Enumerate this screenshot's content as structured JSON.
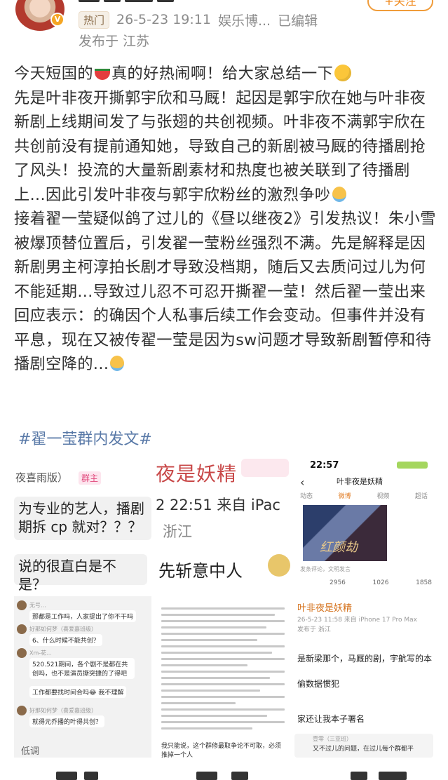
{
  "header": {
    "verified_mark": "V",
    "hot_tag": "热门",
    "timestamp": "26-5-23 19:11",
    "source": "娱乐博...",
    "edited": "已编辑",
    "location": "发布于 江苏",
    "follow_label": "+关注"
  },
  "post": {
    "paragraphs": [
      "今天短国的",
      "真的好热闹啊！给大家总结一下",
      "先是叶非夜开撕郭宇欣和马厩！起因是郭宇欣在她与叶非夜新剧上线期间发了与张翅的共创视频。叶非夜不满郭宇欣在共创前没有提前通知她，导致自己的新剧被马厩的待播剧抢了风头！投流的大量新剧素材和热度也被关联到了待播剧上...因此引发叶非夜与郭宇欣粉丝的激烈争吵",
      "接着翟一莹疑似鸽了过儿的《昼以继夜2》引发热议！朱小雪被爆顶替位置后，引发翟一莹粉丝强烈不满。先是解释是因新剧男主柯淳拍长剧才导致没档期，随后又去质问过儿为何不能延期...导致过儿忍不可忍开撕翟一莹！然后翟一莹出来回应表示：的确因个人私事后续工作会变动。但事件并没有平息，现在又被传翟一莹是因为sw问题才导致新剧暂停和待播剧空降的..."
    ],
    "hashtag": "#翟一莹群内发文#"
  },
  "images": {
    "img1": {
      "title": "夜喜雨版）",
      "badge": "群主",
      "bubble1": "为专业的艺人，播剧期拆 cp 就对？？？",
      "bubble2": "说的很直白是不是？"
    },
    "img2": {
      "title": "夜是妖精",
      "time": "2 22:51  来自 iPac",
      "location": "浙江",
      "motto": "先斩意中人"
    },
    "img3": {
      "status_time": "22:57",
      "name": "叶非夜是妖精",
      "tabs": [
        "动态",
        "微博",
        "视频",
        "超话"
      ],
      "poster_text": "红颜劫",
      "comment_placeholder": "发条评论，文明发言",
      "stats": [
        "2956",
        "1026",
        "1858"
      ]
    },
    "img4": {
      "rows": [
        {
          "name": "无号...",
          "text": "那都是工作吗，人家提出了你不干吗"
        },
        {
          "name": "好那如何梦（喜爱嘉班级）",
          "text": "6、什么时候不能共创？"
        },
        {
          "name": "Xm-花...",
          "text": "520.521期间，各个剧不是都在共创吗，也不是演员撕突捷的了得吧"
        },
        {
          "name": "",
          "text": "工作都要找时间合吗😂 我不理解"
        },
        {
          "name": "好那如何梦（喜爱嘉班级）",
          "text": "就得元乔播的叶得共创？"
        }
      ],
      "footer": "低调"
    },
    "img5": {
      "bottom_text": "我只能说，这个群修最取争论不可取，必须推掉一个人"
    },
    "img6": {
      "name": "叶非夜是妖精",
      "meta": "26-5-23 11:58  来自 iPhone 17 Pro Max",
      "location": "发布于 浙江",
      "lines": [
        "是新梁那个，马厩的剧，宇航写的本",
        "偷数据惯犯",
        "家还让我本子署名"
      ],
      "bubble_name": "壹零（三亚班）",
      "bubble_text": "又不过儿的问题，在过儿每个群都平"
    }
  }
}
